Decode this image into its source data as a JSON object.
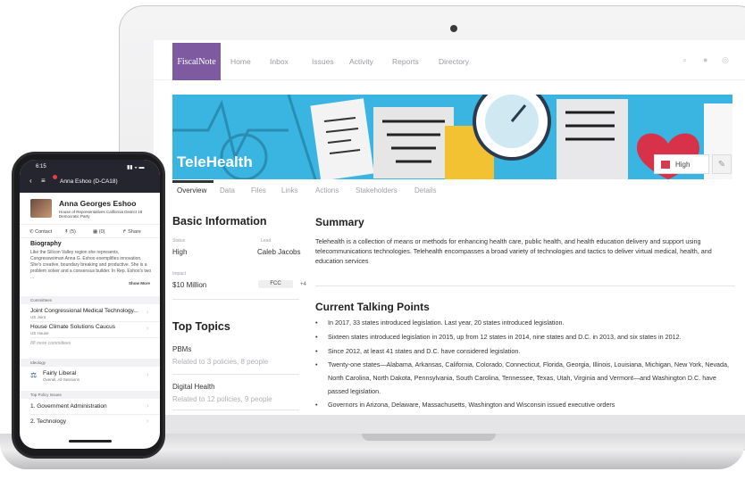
{
  "app": {
    "logo": "FiscalNote",
    "nav": [
      "Home",
      "Inbox",
      "Issues",
      "Activity",
      "Reports",
      "Directory"
    ],
    "nav_icons": [
      "search-icon",
      "bell-icon",
      "user-icon"
    ]
  },
  "issue": {
    "title": "TeleHealth",
    "priority_label": "High",
    "priority_color": "#d43c4e",
    "tabs": [
      "Overview",
      "Data",
      "Files",
      "Links",
      "Actions",
      "Stakeholders",
      "Details"
    ],
    "active_tab": "Overview"
  },
  "basic_info": {
    "heading": "Basic Information",
    "status_label": "Status",
    "status_value": "High",
    "lead_label": "Lead",
    "lead_value": "Caleb Jacobs",
    "impact_label": "Impact",
    "impact_value": "$10 Million",
    "tag": "FCC",
    "tag_more": "+4"
  },
  "top_topics": {
    "heading": "Top Topics",
    "items": [
      {
        "name": "PBMs",
        "sub": "Related to 3 policies, 8 people"
      },
      {
        "name": "Digital Health",
        "sub": "Related to 12 policies, 9 people"
      }
    ]
  },
  "summary": {
    "heading": "Summary",
    "text": "Telehealth is a collection of means or methods for enhancing health care, public health, and health education delivery and support using telecommunications technologies. Telehealth encompasses a broad variety of technologies and tactics to deliver virtual medical, health, and education services"
  },
  "talking_points": {
    "heading": "Current Talking Points",
    "items": [
      "In 2017, 33 states introduced legislation. Last year, 20 states introduced legislation.",
      "Sixteen states introduced legislation in 2015, up from 12 states in 2014, nine states and D.C. in 2013, and six states in 2012.",
      "Since 2012, at least 41 states and D.C. have considered legislation.",
      "Twenty-one states—Alabama, Arkansas, California, Colorado, Connecticut, Florida, Georgia, Illinois, Louisiana, Michigan, New York, Nevada, North Carolina, North Dakota, Pennsylvania, South Carolina, Tennessee, Texas, Utah, Virginia and Vermont—and Washington D.C. have passed legislation.",
      "Governors in Arizona, Delaware, Massachusetts, Washington and Wisconsin issued executive orders"
    ]
  },
  "phone": {
    "time": "6:15",
    "title": "Anna Eshoo (D-CA18)",
    "name": "Anna Georges Eshoo",
    "sub1": "House of Representatives California District 18",
    "sub2": "Democratic Party",
    "actions": [
      "Contact",
      "(5)",
      "(0)",
      "Share"
    ],
    "bio_heading": "Biography",
    "bio": "Like the Silicon Valley region she represents, Congresswoman Anna G. Eshoo exemplifies innovation. She's creative, boundary breaking and productive. She is a problem solver and a consensus builder. In Rep. Eshoo's two ...",
    "show_more": "Show More",
    "committees_label": "Committees",
    "committees": [
      {
        "name": "Joint Congressional Medical Technology...",
        "sub": "US Joint"
      },
      {
        "name": "House Climate Solutions Caucus",
        "sub": "US House"
      }
    ],
    "more_committees": "88 more committees",
    "ideology_label": "Ideology",
    "ideology_value": "Fairly Liberal",
    "ideology_sub": "Overall, All Sessions",
    "policy_label": "Top Policy Issues",
    "policy_items": [
      "1. Government Administration",
      "2. Technology"
    ]
  }
}
